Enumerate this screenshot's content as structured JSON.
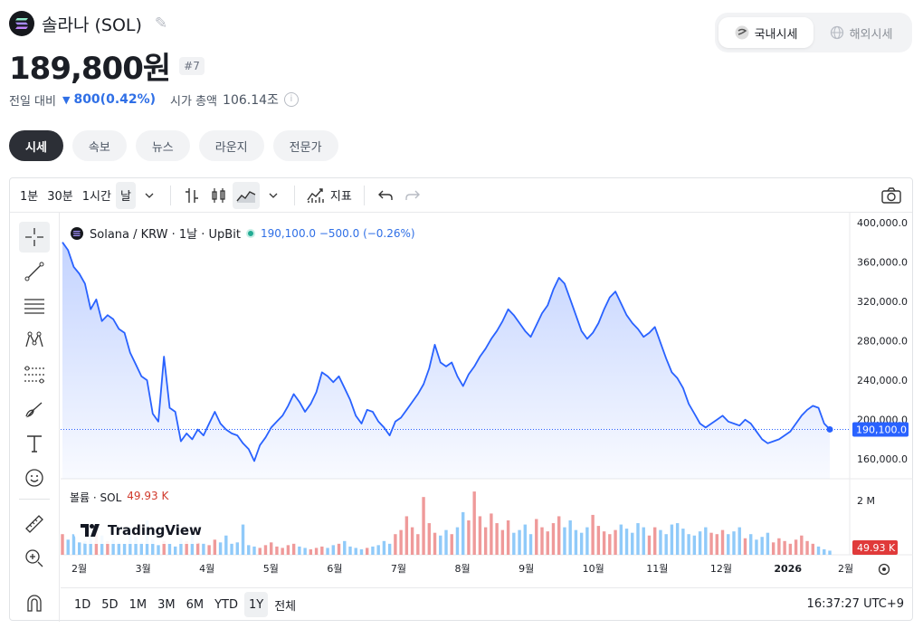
{
  "header": {
    "coin_name": "솔라나 (SOL)",
    "price": "189,800원",
    "rank": "#7",
    "change_label": "전일 대비",
    "change_value": "800(0.42%)",
    "mcap_label": "시가 총액",
    "mcap_value": "106.14조",
    "info_icon": "i"
  },
  "market_toggle": {
    "domestic": "국내시세",
    "overseas": "해외시세",
    "selected": "국내시세"
  },
  "tabs": [
    "시세",
    "속보",
    "뉴스",
    "라운지",
    "전문가"
  ],
  "active_tab": "시세",
  "toolbar": {
    "intervals": [
      "1분",
      "30분",
      "1시간",
      "날"
    ],
    "active_interval": "날",
    "indicators_label": "지표"
  },
  "legend": {
    "symbol": "Solana / KRW · 1날 · UpBit",
    "values": "190,100.0  −500.0 (−0.26%)"
  },
  "volume_legend": {
    "label": "볼륨 · SOL",
    "value": "49.93 K"
  },
  "watermark": "TradingView",
  "ranges": [
    "1D",
    "5D",
    "1M",
    "3M",
    "6M",
    "YTD",
    "1Y",
    "전체"
  ],
  "active_range": "1Y",
  "clock": "16:37:27 UTC+9",
  "colors": {
    "line": "#2962ff",
    "down": "#2f6fe6",
    "vol_up": "#ef9a9a",
    "vol_down": "#90caf9",
    "last_price_tag": "#2962ff",
    "vol_tag": "#e03a3a"
  },
  "chart_data": {
    "type": "area",
    "title": "Solana / KRW · 1날 · UpBit",
    "x_tick_labels": [
      "2월",
      "3월",
      "4월",
      "5월",
      "6월",
      "7월",
      "8월",
      "9월",
      "10월",
      "11월",
      "12월",
      "2026",
      "2월"
    ],
    "y_tick_labels": [
      "400,000.0",
      "360,000.0",
      "320,000.0",
      "280,000.0",
      "240,000.0",
      "200,000.0",
      "160,000.0"
    ],
    "ylim": [
      140000,
      410000
    ],
    "last_price_label": "190,100.0",
    "last_price": 190100,
    "volume_axis_label": "2 M",
    "volume_last_label": "49.93 K",
    "series": [
      {
        "name": "Solana / KRW",
        "values": [
          380000,
          372000,
          355000,
          348000,
          338000,
          312000,
          322000,
          300000,
          306000,
          302000,
          292000,
          288000,
          268000,
          256000,
          244000,
          240000,
          206000,
          198000,
          264000,
          212000,
          208000,
          178000,
          186000,
          180000,
          190000,
          184000,
          196000,
          208000,
          196000,
          190000,
          186000,
          184000,
          176000,
          170000,
          158000,
          174000,
          182000,
          192000,
          198000,
          204000,
          214000,
          226000,
          218000,
          208000,
          216000,
          228000,
          248000,
          244000,
          238000,
          244000,
          232000,
          220000,
          204000,
          196000,
          210000,
          208000,
          198000,
          192000,
          184000,
          198000,
          202000,
          210000,
          218000,
          226000,
          236000,
          252000,
          276000,
          258000,
          254000,
          258000,
          244000,
          234000,
          246000,
          254000,
          264000,
          272000,
          282000,
          290000,
          300000,
          312000,
          306000,
          298000,
          290000,
          284000,
          296000,
          308000,
          316000,
          332000,
          344000,
          338000,
          322000,
          306000,
          290000,
          282000,
          288000,
          298000,
          312000,
          324000,
          330000,
          318000,
          306000,
          298000,
          292000,
          284000,
          288000,
          294000,
          278000,
          262000,
          248000,
          242000,
          232000,
          216000,
          206000,
          196000,
          192000,
          196000,
          200000,
          204000,
          198000,
          196000,
          194000,
          200000,
          196000,
          188000,
          180000,
          176000,
          178000,
          180000,
          184000,
          188000,
          196000,
          204000,
          210000,
          214000,
          212000,
          196000,
          190100
        ]
      }
    ],
    "volume_values": [
      0.3,
      0.22,
      0.3,
      0.18,
      0.2,
      0.24,
      0.36,
      0.28,
      0.2,
      0.22,
      0.18,
      0.16,
      0.4,
      0.26,
      0.18,
      0.5,
      0.22,
      0.14,
      0.2,
      0.16,
      0.12,
      0.24,
      0.2,
      0.3,
      0.18,
      0.16,
      0.14,
      0.22,
      0.18,
      0.28,
      0.16,
      0.18,
      0.44,
      0.14,
      0.12,
      0.1,
      0.14,
      0.18,
      0.12,
      0.1,
      0.14,
      0.16,
      0.12,
      0.1,
      0.08,
      0.1,
      0.12,
      0.1,
      0.14,
      0.16,
      0.2,
      0.12,
      0.1,
      0.08,
      0.1,
      0.12,
      0.14,
      0.2,
      0.16,
      0.3,
      0.36,
      0.56,
      0.4,
      0.3,
      0.84,
      0.46,
      0.32,
      0.28,
      0.36,
      0.3,
      0.4,
      0.62,
      0.5,
      0.92,
      0.56,
      0.4,
      0.6,
      0.46,
      0.36,
      0.5,
      0.32,
      0.36,
      0.44,
      0.3,
      0.52,
      0.4,
      0.34,
      0.46,
      0.56,
      0.4,
      0.5,
      0.36,
      0.32,
      0.4,
      0.58,
      0.42,
      0.34,
      0.3,
      0.36,
      0.44,
      0.38,
      0.32,
      0.46,
      0.4,
      0.28,
      0.4,
      0.36,
      0.3,
      0.44,
      0.46,
      0.38,
      0.3,
      0.28,
      0.34,
      0.4,
      0.32,
      0.3,
      0.36,
      0.3,
      0.34,
      0.4,
      0.24,
      0.3,
      0.22,
      0.26,
      0.32,
      0.18,
      0.24,
      0.2,
      0.16,
      0.22,
      0.28,
      0.2,
      0.16,
      0.12,
      0.08,
      0.06
    ],
    "grid": true,
    "legend": "top-left"
  }
}
